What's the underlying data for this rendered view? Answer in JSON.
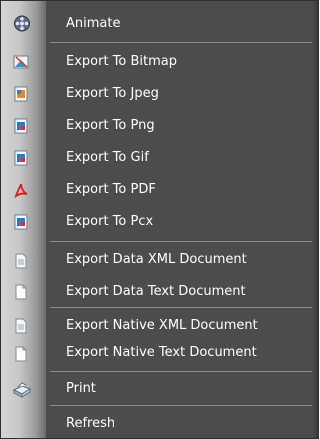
{
  "menu": {
    "items": [
      {
        "label": "Animate",
        "icon": "film-reel-icon"
      },
      {
        "label": "Export To Bitmap",
        "icon": "bitmap-image-icon"
      },
      {
        "label": "Export To Jpeg",
        "icon": "jpeg-image-icon"
      },
      {
        "label": "Export To Png",
        "icon": "png-image-icon"
      },
      {
        "label": "Export To Gif",
        "icon": "gif-image-icon"
      },
      {
        "label": "Export To PDF",
        "icon": "pdf-icon"
      },
      {
        "label": "Export To Pcx",
        "icon": "pcx-image-icon"
      },
      {
        "label": "Export Data XML Document",
        "icon": "xml-document-icon"
      },
      {
        "label": "Export Data Text Document",
        "icon": "text-document-icon"
      },
      {
        "label": "Export Native XML Document",
        "icon": "xml-document-icon"
      },
      {
        "label": "Export Native Text Document",
        "icon": "text-document-icon"
      },
      {
        "label": "Print",
        "icon": "printer-icon"
      },
      {
        "label": "Refresh",
        "icon": ""
      }
    ]
  }
}
